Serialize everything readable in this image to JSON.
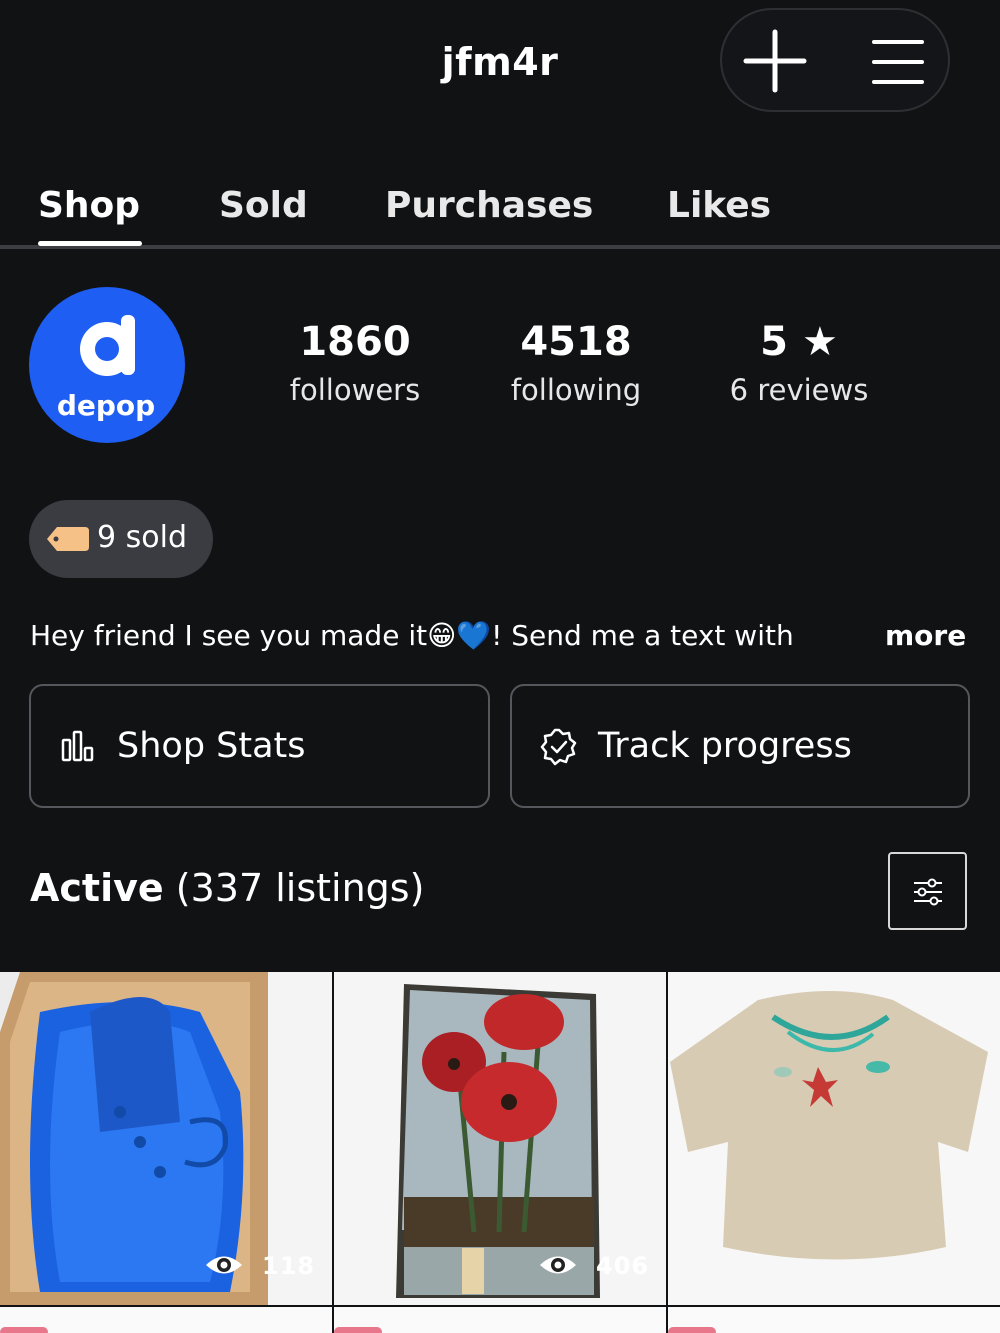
{
  "header": {
    "username": "jfm4r",
    "plus_icon": "plus-icon",
    "menu_icon": "hamburger-menu-icon"
  },
  "tabs": [
    {
      "label": "Shop",
      "active": true
    },
    {
      "label": "Sold",
      "active": false
    },
    {
      "label": "Purchases",
      "active": false
    },
    {
      "label": "Likes",
      "active": false
    }
  ],
  "profile": {
    "avatar_text": "depop",
    "avatar_color": "#1f5ef2",
    "followers": {
      "value": "1860",
      "label": "followers"
    },
    "following": {
      "value": "4518",
      "label": "following"
    },
    "rating": {
      "value": "5",
      "star": "★",
      "label": "6 reviews"
    }
  },
  "sold_badge": {
    "label": "9 sold",
    "icon": "price-tag-icon"
  },
  "bio": {
    "text": "Hey friend I see you made it😁💙! Send me a text with",
    "more": "more"
  },
  "buttons": {
    "shop_stats": {
      "label": "Shop Stats",
      "icon": "bar-chart-icon"
    },
    "track_progress": {
      "label": "Track progress",
      "icon": "badge-check-icon"
    }
  },
  "listings": {
    "heading": "Active",
    "count_text": "(337 listings)",
    "filter_icon": "filter-sliders-icon",
    "items": [
      {
        "name": "blue suede boots",
        "views": "118"
      },
      {
        "name": "poppy flower canvas art",
        "views": "406"
      },
      {
        "name": "jordan graphic t-shirt",
        "views": ""
      }
    ]
  }
}
